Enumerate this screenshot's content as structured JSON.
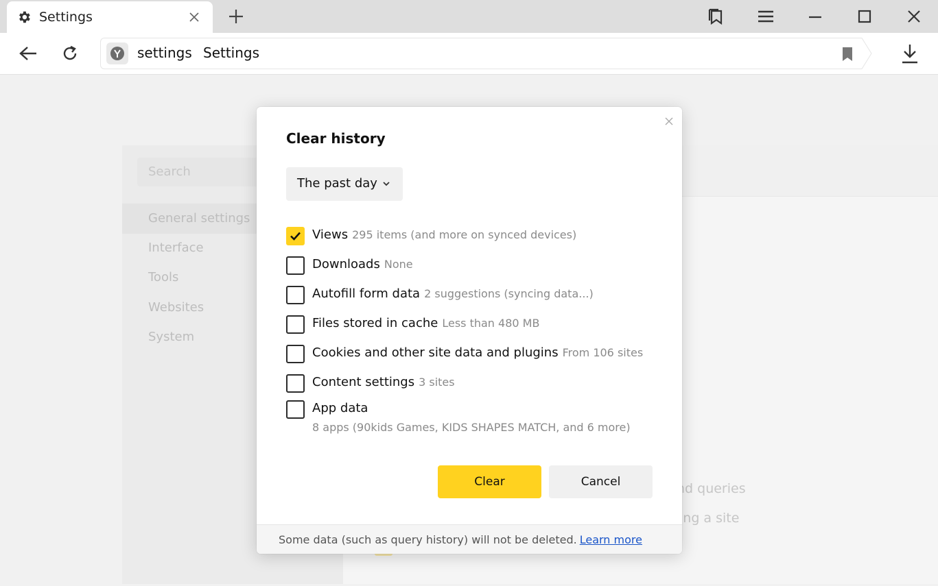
{
  "browser": {
    "tab_title": "Settings",
    "address_host": "settings",
    "address_title": "Settings"
  },
  "settings_page": {
    "search_placeholder": "Search",
    "nav": [
      {
        "label": "General settings",
        "active": true
      },
      {
        "label": "Interface",
        "active": false
      },
      {
        "label": "Tools",
        "active": false
      },
      {
        "label": "Websites",
        "active": false
      },
      {
        "label": "System",
        "active": false
      }
    ],
    "background_fragments": [
      "nd queries",
      "ing a site"
    ]
  },
  "dialog": {
    "title": "Clear history",
    "period": "The past day",
    "items": [
      {
        "label": "Views",
        "detail": "295 items (and more on synced devices)",
        "checked": true
      },
      {
        "label": "Downloads",
        "detail": "None",
        "checked": false
      },
      {
        "label": "Autofill form data",
        "detail": "2 suggestions (syncing data...)",
        "checked": false
      },
      {
        "label": "Files stored in cache",
        "detail": "Less than 480 MB",
        "checked": false
      },
      {
        "label": "Cookies and other site data and plugins",
        "detail": "From 106 sites",
        "checked": false
      },
      {
        "label": "Content settings",
        "detail": "3 sites",
        "checked": false
      },
      {
        "label": "App data",
        "detail": "8 apps (90kids Games, KIDS SHAPES MATCH, and 6 more)",
        "checked": false
      }
    ],
    "clear_label": "Clear",
    "cancel_label": "Cancel",
    "footer_text": "Some data (such as query history) will not be deleted.",
    "footer_link": "Learn more"
  },
  "colors": {
    "accent": "#ffd21f",
    "link": "#1a55c9"
  }
}
